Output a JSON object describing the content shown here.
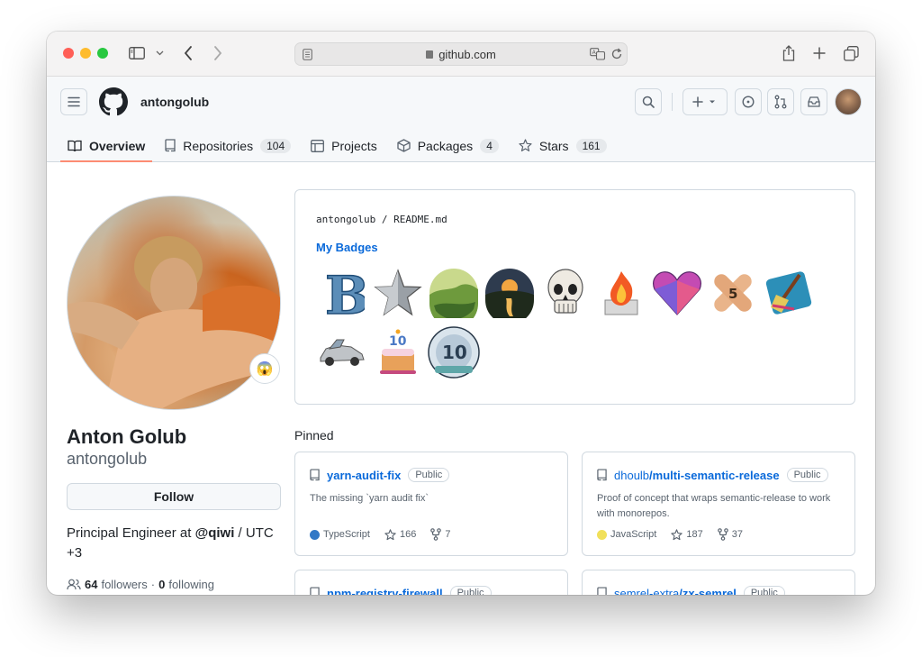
{
  "browser": {
    "url": "github.com"
  },
  "header": {
    "username": "antongolub"
  },
  "tabs": [
    {
      "label": "Overview",
      "count": null
    },
    {
      "label": "Repositories",
      "count": "104"
    },
    {
      "label": "Projects",
      "count": null
    },
    {
      "label": "Packages",
      "count": "4"
    },
    {
      "label": "Stars",
      "count": "161"
    }
  ],
  "profile": {
    "full_name": "Anton Golub",
    "login": "antongolub",
    "status_emoji": "😱",
    "follow_label": "Follow",
    "bio_prefix": "Principal Engineer at ",
    "bio_org": "@qiwi",
    "bio_suffix": " / UTC +3",
    "followers_count": "64",
    "followers_label": "followers",
    "separator": "·",
    "following_count": "0",
    "following_label": "following"
  },
  "readme": {
    "owner": "antongolub",
    "slash": "/",
    "file": "README",
    "ext": ".md",
    "title": "My Badges",
    "badges": [
      "letter-b-badge",
      "star-badge",
      "landscape-badge",
      "sunset-river-badge",
      "skull-badge",
      "fire-badge",
      "heart-gem-badge",
      "bandage-5-badge",
      "broom-badge",
      "delorean-badge",
      "cake-10-badge",
      "anniversary-10-badge"
    ]
  },
  "pinned": {
    "title": "Pinned",
    "repos": [
      {
        "owner": "",
        "name": "yarn-audit-fix",
        "visibility": "Public",
        "description": "The missing `yarn audit fix`",
        "language": "TypeScript",
        "lang_color": "#3178c6",
        "stars": "166",
        "forks": "7"
      },
      {
        "owner": "dhoulb",
        "name": "/multi-semantic-release",
        "visibility": "Public",
        "description": "Proof of concept that wraps semantic-release to work with monorepos.",
        "language": "JavaScript",
        "lang_color": "#f1e05a",
        "stars": "187",
        "forks": "37"
      },
      {
        "owner": "",
        "name": "npm-registry-firewall",
        "visibility": "Public"
      },
      {
        "owner": "semrel-extra",
        "name": "/zx-semrel",
        "visibility": "Public"
      }
    ]
  }
}
